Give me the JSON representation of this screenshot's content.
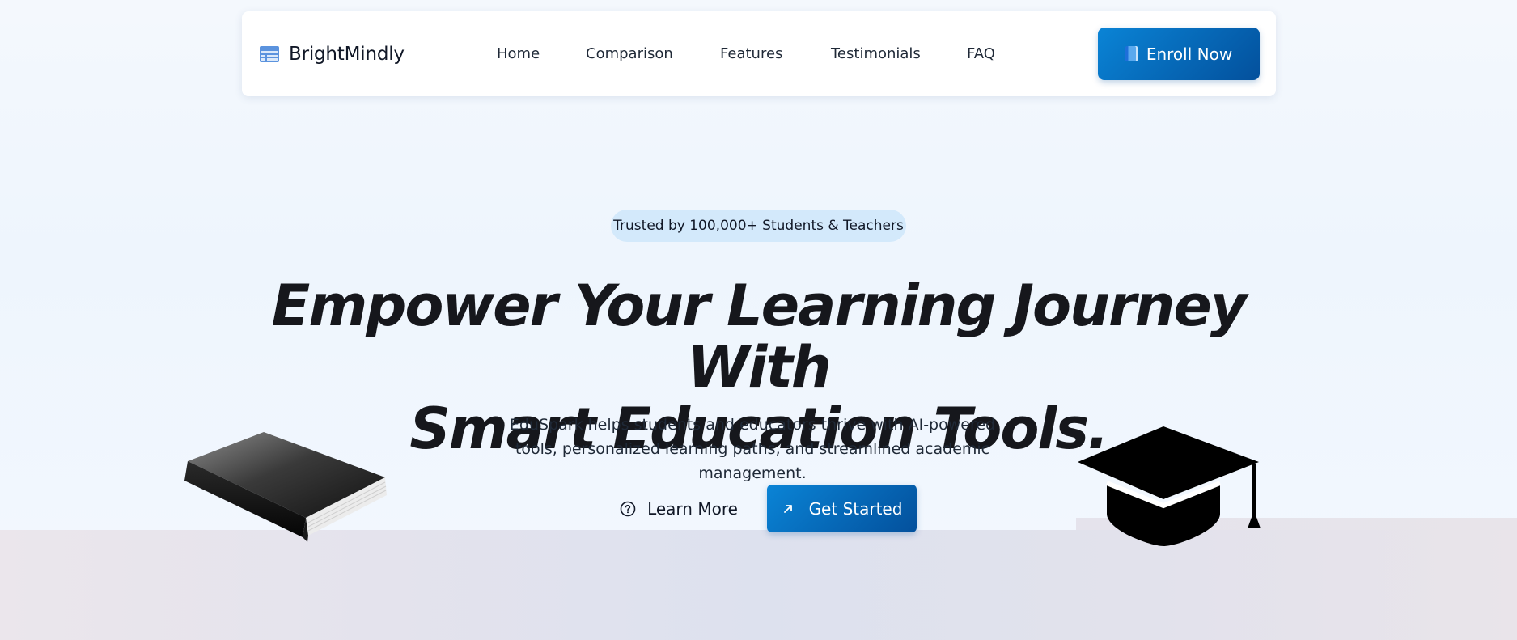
{
  "navbar": {
    "brand": {
      "name": "BrightMindly",
      "icon": "table-layout-icon"
    },
    "links": [
      {
        "label": "Home"
      },
      {
        "label": "Comparison"
      },
      {
        "label": "Features"
      },
      {
        "label": "Testimonials"
      },
      {
        "label": "FAQ"
      }
    ],
    "cta": {
      "label": "Enroll Now",
      "icon": "blue-book-icon"
    }
  },
  "hero": {
    "badge": "Trusted by 100,000+ Students & Teachers",
    "title_line1": "Empower Your Learning Journey With",
    "title_line2": "Smart Education Tools.",
    "subtitle": "EduSpark helps students and educators thrive with AI-powered tools, personalized learning paths, and streamlined academic management.",
    "secondary_button": {
      "label": "Learn More",
      "icon": "help-circle-icon"
    },
    "primary_button": {
      "label": "Get Started",
      "icon": "arrow-up-right-icon"
    },
    "decorations": [
      "closed-book-image",
      "graduation-cap-icon"
    ]
  },
  "colors": {
    "accent_start": "#0a84d6",
    "accent_end": "#03509c",
    "badge_bg": "#d3e9fb",
    "title": "#16171c"
  }
}
